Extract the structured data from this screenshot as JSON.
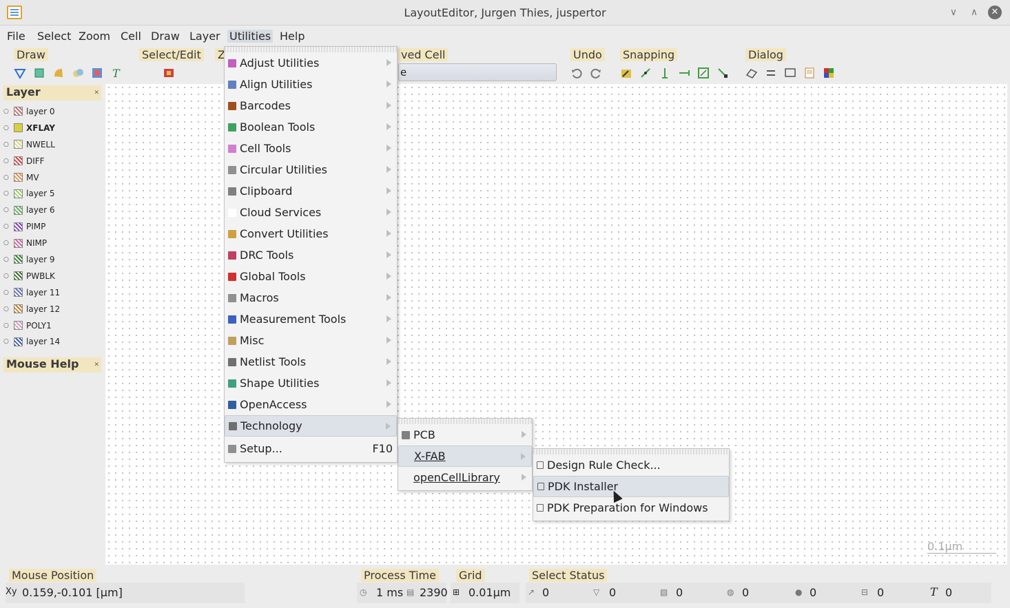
{
  "window": {
    "title": "LayoutEditor, Jurgen Thies, juspertor"
  },
  "menubar": {
    "items": [
      "File",
      "Select",
      "Zoom",
      "Cell",
      "Draw",
      "Layer",
      "Utilities",
      "Help"
    ]
  },
  "toolbars": {
    "draw": "Draw",
    "select_edit": "Select/Edit",
    "zoom_partial": "Z",
    "cell_partial": "ved Cell",
    "cell_combo_value": "e",
    "undo": "Undo",
    "snapping": "Snapping",
    "dialog": "Dialog"
  },
  "layer_dock": {
    "title": "Layer",
    "layers": [
      {
        "name": "layer 0",
        "color": "#c07070",
        "bold": false
      },
      {
        "name": "XFLAY",
        "color": "#d8d040",
        "bold": true
      },
      {
        "name": "NWELL",
        "color": "#d8d890",
        "bold": false
      },
      {
        "name": "DIFF",
        "color": "#d04040",
        "bold": false
      },
      {
        "name": "MV",
        "color": "#e09050",
        "bold": false
      },
      {
        "name": "layer 5",
        "color": "#a0d070",
        "bold": false
      },
      {
        "name": "layer 6",
        "color": "#60b060",
        "bold": false
      },
      {
        "name": "PIMP",
        "color": "#8040c0",
        "bold": false
      },
      {
        "name": "NIMP",
        "color": "#d060a0",
        "bold": false
      },
      {
        "name": "layer 9",
        "color": "#308030",
        "bold": false
      },
      {
        "name": "PWBLK",
        "color": "#407030",
        "bold": false
      },
      {
        "name": "layer 11",
        "color": "#6070c0",
        "bold": false
      },
      {
        "name": "layer 12",
        "color": "#c08030",
        "bold": false
      },
      {
        "name": "POLY1",
        "color": "#d0a0c0",
        "bold": false
      },
      {
        "name": "layer 14",
        "color": "#4060a0",
        "bold": false
      }
    ]
  },
  "mouse_help_dock": {
    "title": "Mouse Help"
  },
  "canvas": {
    "scale_label": "0.1µm"
  },
  "utilities_menu": {
    "items": [
      {
        "label": "Adjust Utilities",
        "submenu": true,
        "icon_color": "#c060c0"
      },
      {
        "label": "Align Utilities",
        "submenu": true,
        "icon_color": "#6080c0"
      },
      {
        "label": "Barcodes",
        "submenu": true,
        "icon_color": "#a05020"
      },
      {
        "label": "Boolean Tools",
        "submenu": true,
        "icon_color": "#40a060"
      },
      {
        "label": "Cell Tools",
        "submenu": true,
        "icon_color": "#d080d0"
      },
      {
        "label": "Circular Utilities",
        "submenu": true,
        "icon_color": "#909090"
      },
      {
        "label": "Clipboard",
        "submenu": true,
        "icon_color": "#808080"
      },
      {
        "label": "Cloud Services",
        "submenu": true,
        "icon_color": "#ffffff"
      },
      {
        "label": "Convert Utilities",
        "submenu": true,
        "icon_color": "#d0a040"
      },
      {
        "label": "DRC Tools",
        "submenu": true,
        "icon_color": "#c04060"
      },
      {
        "label": "Global Tools",
        "submenu": true,
        "icon_color": "#d03030"
      },
      {
        "label": "Macros",
        "submenu": true,
        "icon_color": "#909090"
      },
      {
        "label": "Measurement Tools",
        "submenu": true,
        "icon_color": "#4060c0"
      },
      {
        "label": "Misc",
        "submenu": true,
        "icon_color": "#c0a060"
      },
      {
        "label": "Netlist Tools",
        "submenu": true,
        "icon_color": "#707070"
      },
      {
        "label": "Shape Utilities",
        "submenu": true,
        "icon_color": "#40a080"
      },
      {
        "label": "OpenAccess",
        "submenu": true,
        "icon_color": "#3060a0"
      },
      {
        "label": "Technology",
        "submenu": true,
        "icon_color": "#707070",
        "highlighted": true
      }
    ],
    "setup": {
      "label": "Setup...",
      "shortcut": "F10"
    }
  },
  "technology_menu": {
    "items": [
      {
        "label": "PCB",
        "submenu": true,
        "highlighted": false
      },
      {
        "label": "X-FAB",
        "submenu": true,
        "highlighted": true
      },
      {
        "label": "openCellLibrary",
        "submenu": true,
        "highlighted": false
      }
    ]
  },
  "xfab_menu": {
    "items": [
      {
        "label": "Design Rule Check...",
        "highlighted": false
      },
      {
        "label": "PDK Installer",
        "highlighted": true
      },
      {
        "label": "PDK Preparation for Windows",
        "highlighted": false
      }
    ]
  },
  "statusbar": {
    "mouse_position_title": "Mouse Position",
    "mouse_position_value": "0.159,-0.101 [µm]",
    "process_time_title": "Process Time",
    "process_time_value": "1 ms",
    "process_count": "2390",
    "grid_title": "Grid",
    "grid_value": "0.01µm",
    "select_status_title": "Select Status",
    "select_counts": [
      "0",
      "0",
      "0",
      "0",
      "0",
      "0",
      "0"
    ]
  }
}
